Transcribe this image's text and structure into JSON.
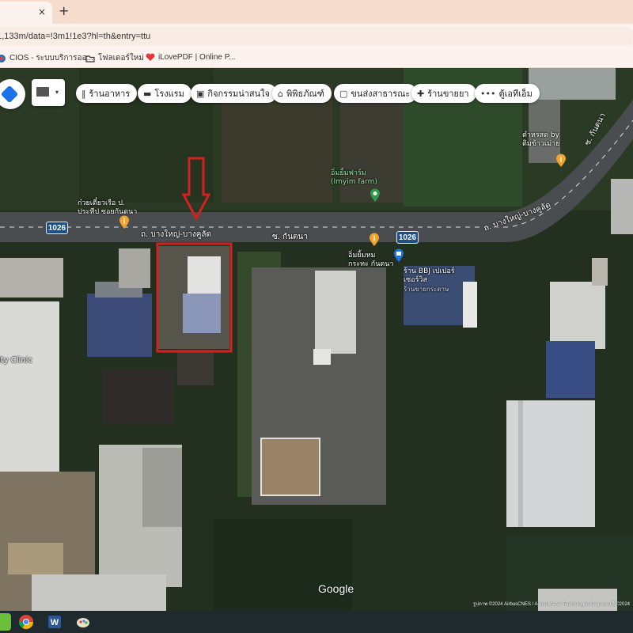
{
  "browser": {
    "tab_close_glyph": "×",
    "new_tab_glyph": "+",
    "url_text": "01,133m/data=!3m1!1e3?hl=th&entry=ttu",
    "bookmarks": [
      {
        "label": "CIOS - ระบบบริการออ...",
        "icon": "cios-icon"
      },
      {
        "label": "โฟลเดอร์ใหม่",
        "icon": "folder-icon"
      },
      {
        "label": "iLovePDF | Online P...",
        "icon": "ilovepdf-icon"
      }
    ]
  },
  "map": {
    "category_chips": [
      {
        "icon": "restaurant-icon",
        "glyph": "‖",
        "label": "ร้านอาหาร"
      },
      {
        "icon": "hotel-icon",
        "glyph": "▬",
        "label": "โรงแรม"
      },
      {
        "icon": "camera-icon",
        "glyph": "▣",
        "label": "กิจกรรมน่าสนใจ"
      },
      {
        "icon": "museum-icon",
        "glyph": "⌂",
        "label": "พิพิธภัณฑ์"
      },
      {
        "icon": "transit-icon",
        "glyph": "▢",
        "label": "ขนส่งสาธารณะ"
      },
      {
        "icon": "pharmacy-icon",
        "glyph": "✚",
        "label": "ร้านขายยา"
      },
      {
        "icon": "atm-icon",
        "glyph": "•••",
        "label": "ตู้เอทีเอ็ม"
      }
    ],
    "road_labels": {
      "main_road_left": "ถ. บางใหญ่-บางคูลัด",
      "main_road_right": "ถ. บางใหญ่-บางคูลัด",
      "soi": "ซ. กันตนา",
      "soi_right": "ซ. กันตนา"
    },
    "route_shields": [
      "1026",
      "1026"
    ],
    "poi": {
      "noodle_line1": "ก๋วยเตี๋ยวเรือ ป.",
      "noodle_line2": "ประทีป ซอยกันตนา",
      "farm_line1": "อิ่มยิ้มฟาร์ม",
      "farm_line2": "(Imyim farm)",
      "rest_line1": "อิ่มยิ้มหม",
      "rest_line2": "กระทะ กันตนา",
      "store_line1": "ร้าน BBJ เปเปอร์",
      "store_line2": "เซอร์วิส",
      "store_line3": "ร้านขายกระดาษ",
      "grill_line1": "ตำหรสด by",
      "grill_line2": "ติมข้าวเม่าย",
      "clinic": "ity Clinic"
    },
    "google_logo": "Google",
    "attribution": "รูปภาพ ©2024 AirbusCNES / AirbusMaxar Technologiesข้อมูลแผนที่ ©2024"
  },
  "colors": {
    "accent_blue": "#1a73e8",
    "marker_red": "#d42020",
    "poi_orange": "#f2a32c",
    "poi_green": "#2e9c4a",
    "shield_blue": "#1c4f8a"
  }
}
